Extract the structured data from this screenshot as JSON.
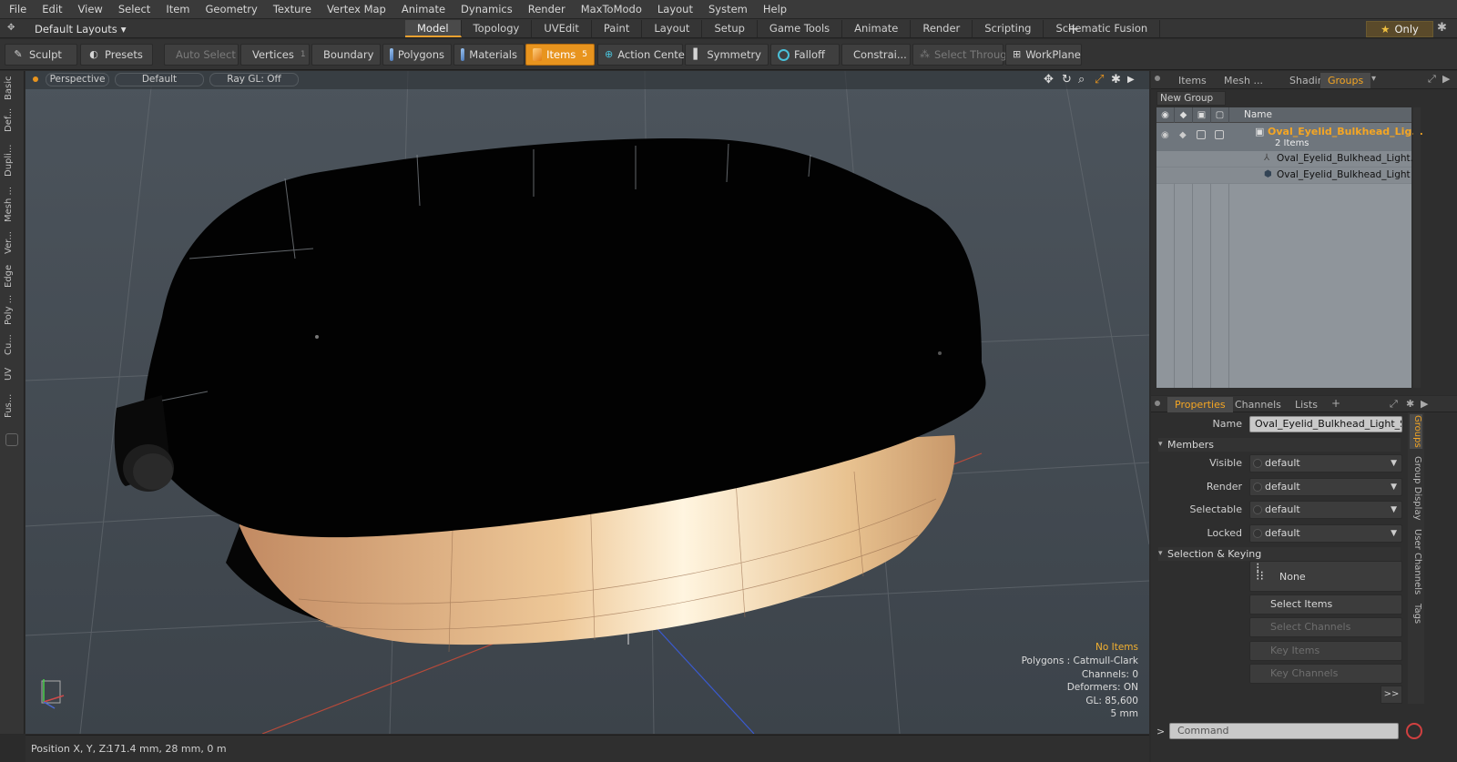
{
  "menu": [
    "File",
    "Edit",
    "View",
    "Select",
    "Item",
    "Geometry",
    "Texture",
    "Vertex Map",
    "Animate",
    "Dynamics",
    "Render",
    "MaxToModo",
    "Layout",
    "System",
    "Help"
  ],
  "layout": {
    "preset": "Default Layouts",
    "tabs": [
      "Model",
      "Topology",
      "UVEdit",
      "Paint",
      "Layout",
      "Setup",
      "Game Tools",
      "Animate",
      "Render",
      "Scripting",
      "Schematic Fusion"
    ],
    "active_tab": "Model",
    "only_label": "Only"
  },
  "toolbar": {
    "sculpt": "Sculpt",
    "presets": "Presets",
    "auto_select": "Auto Select",
    "vertices": "Vertices",
    "vertices_key": "1",
    "boundary": "Boundary",
    "polygons": "Polygons",
    "materials": "Materials",
    "items": "Items",
    "items_key": "5",
    "action_center": "Action Center",
    "symmetry": "Symmetry",
    "falloff": "Falloff",
    "constraints": "Constrai...",
    "select_through": "Select Through",
    "workplane": "WorkPlane"
  },
  "left_tabs": [
    "Basic",
    "Def...",
    "Dupli...",
    "Mesh ...",
    "Ver...",
    "Edge",
    "Poly ...",
    "Cu...",
    "UV",
    "Fus..."
  ],
  "viewport": {
    "view": "Perspective",
    "shading": "Default",
    "raygl": "Ray GL: Off",
    "stats": {
      "no_items": "No Items",
      "polygons": "Polygons : Catmull-Clark",
      "channels": "Channels: 0",
      "deformers": "Deformers: ON",
      "gl": "GL: 85,600",
      "scale": "5 mm"
    }
  },
  "status": {
    "pos_label": "Position X, Y, Z:",
    "pos_value": "171.4 mm, 28 mm, 0 m"
  },
  "groups_panel": {
    "tabs": [
      "Items",
      "Mesh ...",
      "Shading",
      "Groups"
    ],
    "active_tab": "Groups",
    "new_group": "New Group",
    "name_header": "Name",
    "group_name": "Oval_Eyelid_Bulkhead_Lig...",
    "group_count": "2 Items",
    "children": [
      "Oval_Eyelid_Bulkhead_Light...",
      "Oval_Eyelid_Bulkhead_Light"
    ]
  },
  "properties": {
    "tabs": [
      "Properties",
      "Channels",
      "Lists"
    ],
    "active_tab": "Properties",
    "name_label": "Name",
    "name_value": "Oval_Eyelid_Bulkhead_Light_Swit",
    "members_section": "Members",
    "visible_label": "Visible",
    "visible_value": "default",
    "render_label": "Render",
    "render_value": "default",
    "selectable_label": "Selectable",
    "selectable_value": "default",
    "locked_label": "Locked",
    "locked_value": "default",
    "selection_section": "Selection & Keying",
    "none_label": "None",
    "select_items": "Select Items",
    "select_channels": "Select Channels",
    "key_items": "Key Items",
    "key_channels": "Key Channels",
    "more": ">>",
    "side_tabs": [
      "Groups",
      "Group Display",
      "User Channels",
      "Tags"
    ],
    "command_placeholder": "Command"
  },
  "colors": {
    "accent": "#e8941e",
    "group_title": "#f5a623"
  }
}
